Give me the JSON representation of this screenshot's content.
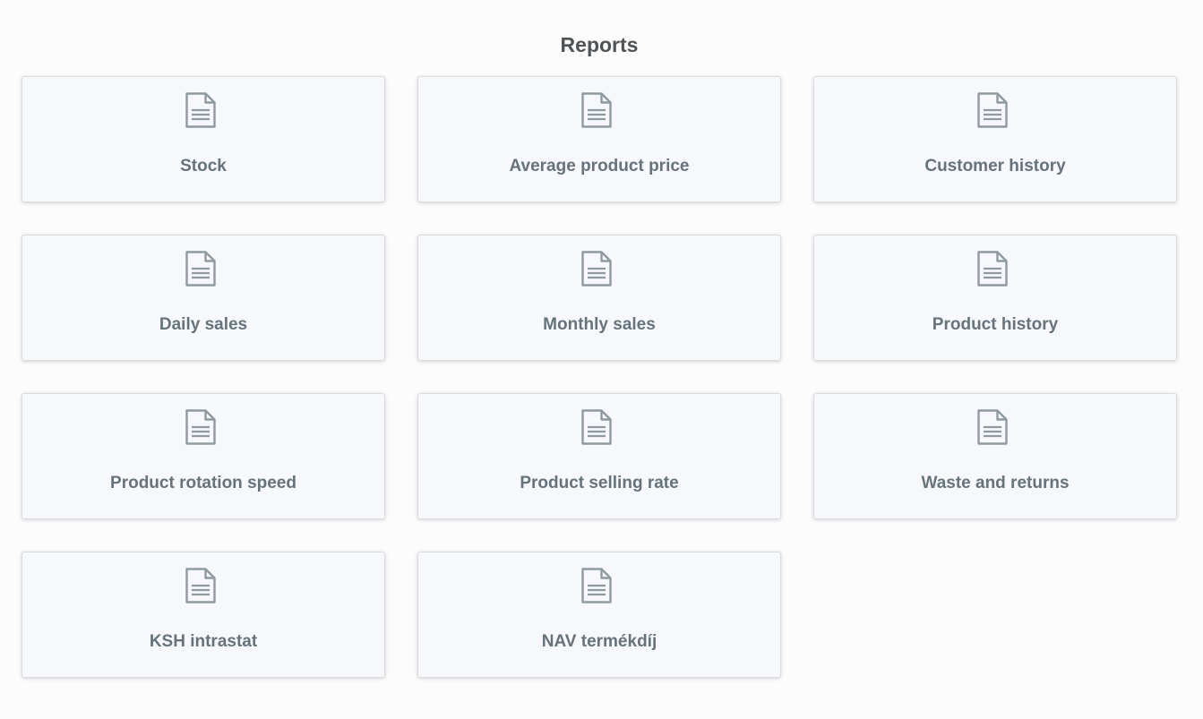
{
  "page": {
    "title": "Reports"
  },
  "reports": [
    {
      "label": "Stock",
      "icon": "document-icon"
    },
    {
      "label": "Average product price",
      "icon": "document-icon"
    },
    {
      "label": "Customer history",
      "icon": "document-icon"
    },
    {
      "label": "Daily sales",
      "icon": "document-icon"
    },
    {
      "label": "Monthly sales",
      "icon": "document-icon"
    },
    {
      "label": "Product history",
      "icon": "document-icon"
    },
    {
      "label": "Product rotation speed",
      "icon": "document-icon"
    },
    {
      "label": "Product selling rate",
      "icon": "document-icon"
    },
    {
      "label": "Waste and returns",
      "icon": "document-icon"
    },
    {
      "label": "KSH intrastat",
      "icon": "document-icon"
    },
    {
      "label": "NAV termékdíj",
      "icon": "document-icon"
    }
  ],
  "colors": {
    "icon_stroke": "#8f9aa0",
    "label": "#66737b",
    "card_background": "#f6f8fb"
  }
}
